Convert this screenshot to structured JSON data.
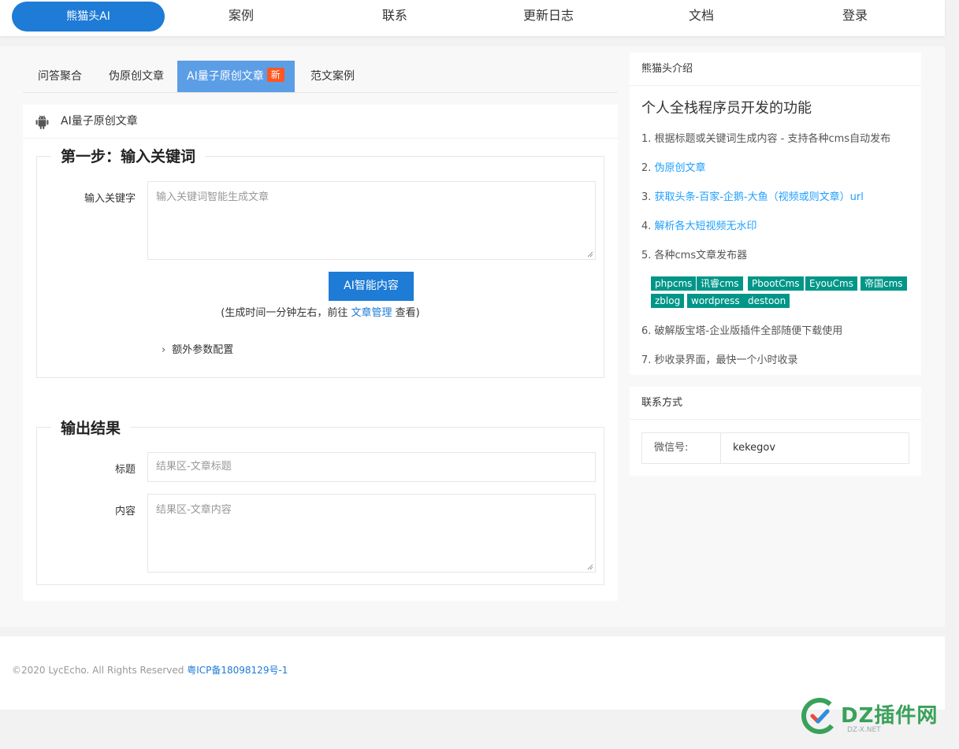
{
  "nav": {
    "brand": "熊猫头AI",
    "items": [
      "案例",
      "联系",
      "更新日志",
      "文档",
      "登录"
    ]
  },
  "tabs": [
    {
      "label": "问答聚合"
    },
    {
      "label": "伪原创文章"
    },
    {
      "label": "AI量子原创文章",
      "badge": "新",
      "active": true
    },
    {
      "label": "范文案例"
    }
  ],
  "main": {
    "card_title": "AI量子原创文章",
    "step1": {
      "legend": "第一步：输入关键词",
      "keyword_label": "输入关键字",
      "keyword_placeholder": "输入关键词智能生成文章",
      "button": "AI智能内容",
      "hint_prefix": "(生成时间一分钟左右，前往 ",
      "hint_link": "文章管理",
      "hint_suffix": " 查看)",
      "extra": "额外参数配置"
    },
    "output": {
      "legend": "输出结果",
      "title_label": "标题",
      "title_placeholder": "结果区-文章标题",
      "content_label": "内容",
      "content_placeholder": "结果区-文章内容"
    }
  },
  "intro": {
    "header": "熊猫头介绍",
    "title": "个人全栈程序员开发的功能",
    "features": [
      {
        "text": "1. 根据标题或关键词生成内容 - 支持各种cms自动发布"
      },
      {
        "prefix": "2. ",
        "link": "伪原创文章"
      },
      {
        "prefix": "3. ",
        "link": "获取头条-百家-企鹅-大鱼（视频或则文章）url"
      },
      {
        "prefix": "4. ",
        "link": "解析各大短视频无水印"
      },
      {
        "text": "5. 各种cms文章发布器"
      },
      {
        "text": "6. 破解版宝塔-企业版插件全部随便下载使用"
      },
      {
        "text": "7. 秒收录界面，最快一个小时收录"
      }
    ],
    "tags": [
      "phpcms",
      "讯睿cms",
      "PbootCms",
      "EyouCms",
      "帝国cms",
      "zblog",
      "wordpress",
      "destoon"
    ]
  },
  "contact": {
    "header": "联系方式",
    "key": "微信号:",
    "value": "kekegov"
  },
  "footer": {
    "copyright": "©2020 LycEcho. All Rights Reserved ",
    "icp": "粤ICP备18098129号-1"
  },
  "watermark": {
    "text": "DZ插件网",
    "sub": "DZ-X.NET"
  },
  "colors": {
    "primary": "#1e7bd6",
    "tab_active": "#5b9ee6",
    "badge": "#ff5722",
    "tag": "#009688",
    "link": "#1e9fff"
  }
}
